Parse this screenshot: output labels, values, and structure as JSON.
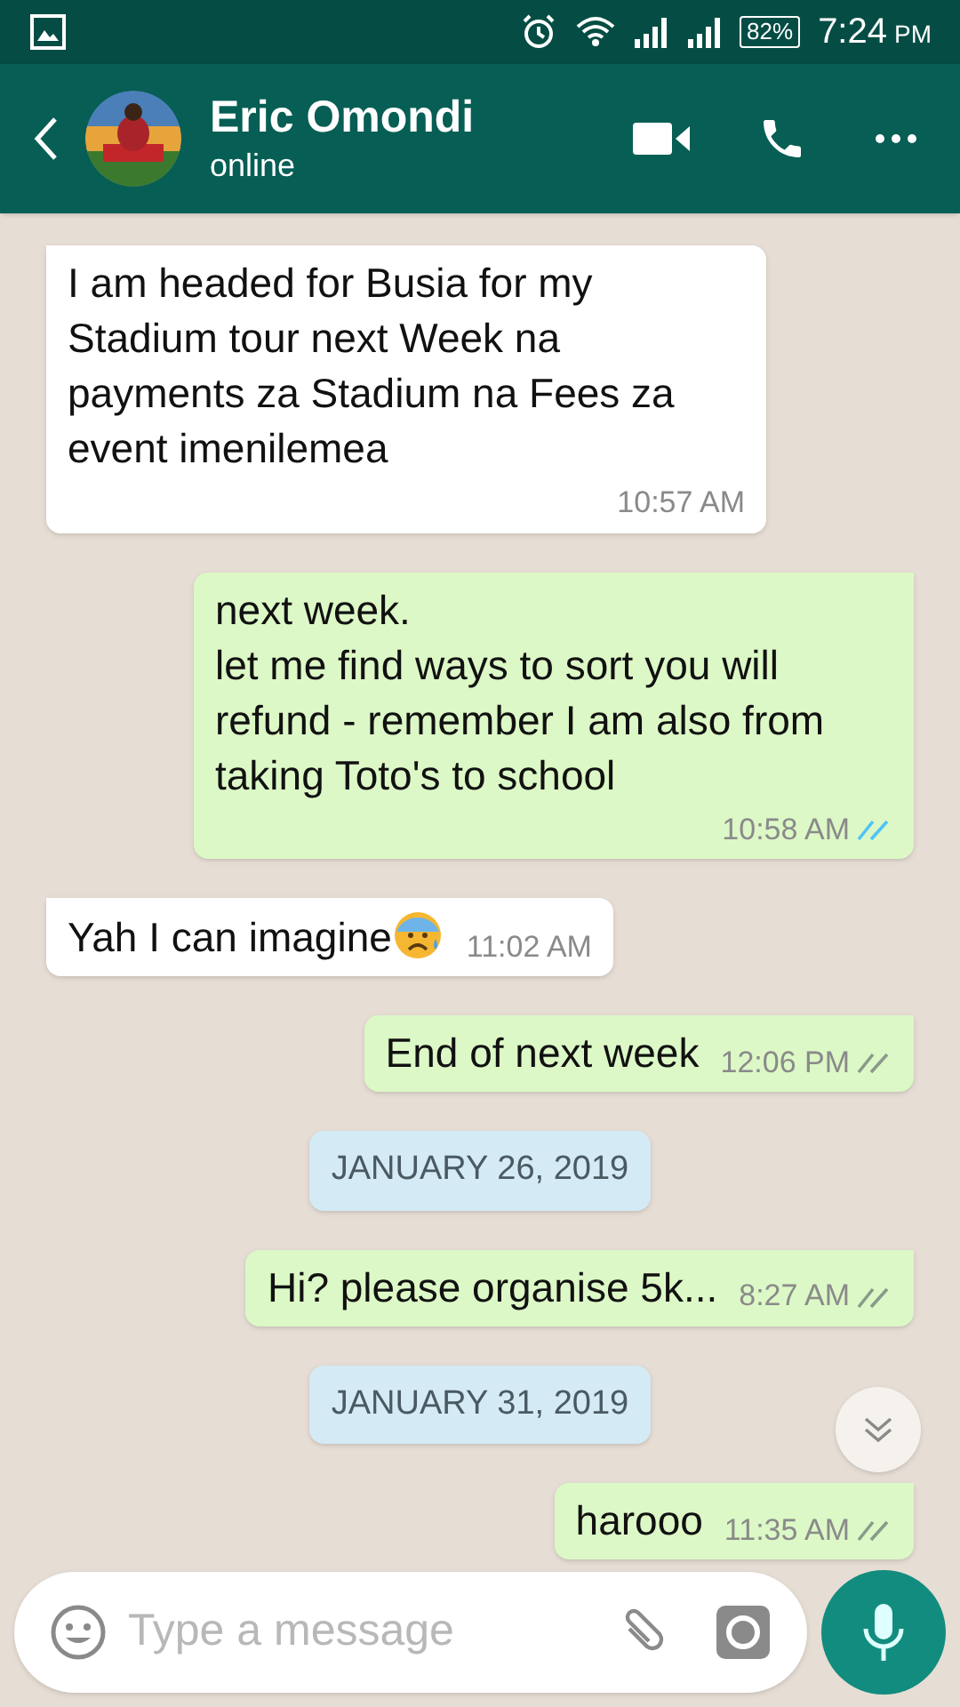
{
  "status_bar": {
    "battery": "82%",
    "time": "7:24",
    "meridiem": "PM"
  },
  "header": {
    "name": "Eric Omondi",
    "status": "online"
  },
  "messages": [
    {
      "kind": "in",
      "text": "I am headed for Busia for my Stadium tour next Week na payments za Stadium na Fees za event imenilemea",
      "time": "10:57 AM"
    },
    {
      "kind": "out",
      "text": "next week.\nlet me find ways to sort you will refund - remember I am also from taking Toto's to school",
      "time": "10:58 AM",
      "read": true
    },
    {
      "kind": "in",
      "text": "Yah I can imagine",
      "emoji": true,
      "time": "11:02 AM"
    },
    {
      "kind": "out",
      "text": "End of next week",
      "time": "12:06 PM",
      "read": false
    },
    {
      "kind": "date",
      "text": "JANUARY 26, 2019"
    },
    {
      "kind": "out",
      "text": "Hi? please organise 5k...",
      "time": "8:27 AM",
      "read": false
    },
    {
      "kind": "date",
      "text": "JANUARY 31, 2019"
    },
    {
      "kind": "out",
      "text": "harooo",
      "time": "11:35 AM",
      "read": false
    }
  ],
  "composer": {
    "placeholder": "Type a message"
  }
}
